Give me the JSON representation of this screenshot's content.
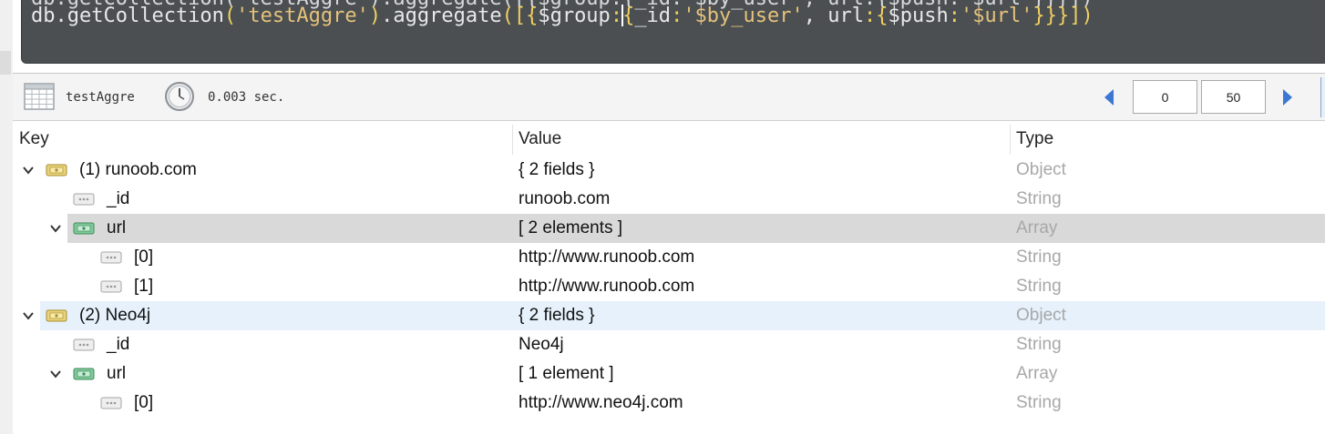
{
  "editor": {
    "query_tokens": [
      {
        "t": "db.getCollection",
        "c": "tk-plain"
      },
      {
        "t": "(",
        "c": "tk-punc"
      },
      {
        "t": "'testAggre'",
        "c": "tk-str"
      },
      {
        "t": ")",
        "c": "tk-punc"
      },
      {
        "t": ".aggregate",
        "c": "tk-plain"
      },
      {
        "t": "([{",
        "c": "tk-punc"
      },
      {
        "t": "$group",
        "c": "tk-key"
      },
      {
        "t": ":",
        "c": "tk-punc"
      },
      {
        "caret": true
      },
      {
        "t": "{",
        "c": "tk-punc"
      },
      {
        "t": "_id",
        "c": "tk-key"
      },
      {
        "t": ":",
        "c": "tk-punc"
      },
      {
        "t": "'$by_user'",
        "c": "tk-str"
      },
      {
        "t": ", ",
        "c": "tk-plain"
      },
      {
        "t": "url",
        "c": "tk-key"
      },
      {
        "t": ":",
        "c": "tk-punc"
      },
      {
        "t": "{",
        "c": "tk-punc"
      },
      {
        "t": "$push",
        "c": "tk-key"
      },
      {
        "t": ":",
        "c": "tk-punc"
      },
      {
        "t": "'$url'",
        "c": "tk-str"
      },
      {
        "t": "}}}])",
        "c": "tk-punc"
      }
    ]
  },
  "toolbar": {
    "collection_icon": "table-grid-icon",
    "collection_name": "testAggre",
    "timer_icon": "clock-icon",
    "exec_time": "0.003 sec.",
    "prev_icon": "triangle-left-icon",
    "next_icon": "triangle-right-icon",
    "skip_value": "0",
    "limit_value": "50"
  },
  "table": {
    "headers": {
      "key": "Key",
      "value": "Value",
      "type": "Type"
    },
    "rows": [
      {
        "level": 0,
        "chevron": "expanded",
        "icon": "object",
        "key": "(1) runoob.com",
        "value": "{ 2 fields }",
        "type": "Object",
        "state": ""
      },
      {
        "level": 1,
        "chevron": "none",
        "icon": "string",
        "key": "_id",
        "value": "runoob.com",
        "type": "String",
        "state": ""
      },
      {
        "level": 1,
        "chevron": "expanded",
        "icon": "array",
        "key": "url",
        "value": "[ 2 elements ]",
        "type": "Array",
        "state": "selected"
      },
      {
        "level": 2,
        "chevron": "none",
        "icon": "string",
        "key": "[0]",
        "value": "http://www.runoob.com",
        "type": "String",
        "state": ""
      },
      {
        "level": 2,
        "chevron": "none",
        "icon": "string",
        "key": "[1]",
        "value": "http://www.runoob.com",
        "type": "String",
        "state": ""
      },
      {
        "level": 0,
        "chevron": "expanded",
        "icon": "object",
        "key": "(2) Neo4j",
        "value": "{ 2 fields }",
        "type": "Object",
        "state": "hover"
      },
      {
        "level": 1,
        "chevron": "none",
        "icon": "string",
        "key": "_id",
        "value": "Neo4j",
        "type": "String",
        "state": ""
      },
      {
        "level": 1,
        "chevron": "expanded",
        "icon": "array",
        "key": "url",
        "value": "[ 1 element ]",
        "type": "Array",
        "state": ""
      },
      {
        "level": 2,
        "chevron": "none",
        "icon": "string",
        "key": "[0]",
        "value": "http://www.neo4j.com",
        "type": "String",
        "state": ""
      }
    ]
  },
  "colors": {
    "editor_bg": "#4b4f52",
    "selected_row": "#d9d9d9",
    "hover_row": "#e6f1fb",
    "type_text": "#a8a8a8",
    "nav_arrow": "#3a78d4"
  }
}
